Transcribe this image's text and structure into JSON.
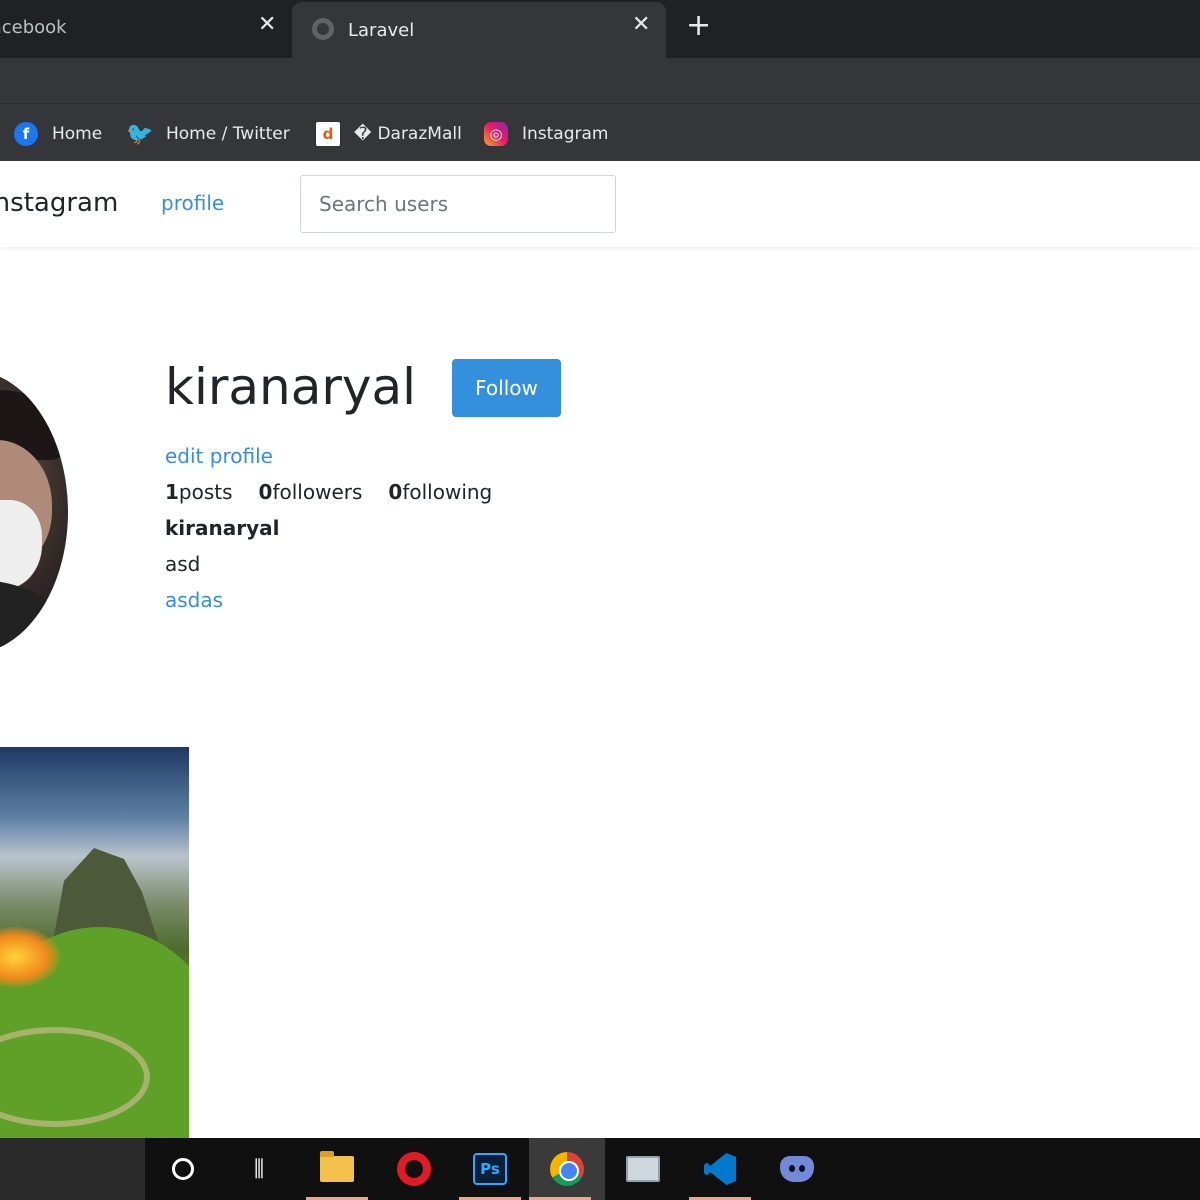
{
  "browser": {
    "tabs": [
      {
        "title": "Facebook",
        "close": "✕"
      },
      {
        "title": "Laravel",
        "close": "✕"
      }
    ],
    "new_tab": "+",
    "bookmarks": [
      {
        "label": "Home",
        "icon": "facebook-icon"
      },
      {
        "label": "Home / Twitter",
        "icon": "twitter-icon"
      },
      {
        "label": "DarazMall",
        "icon": "daraz-icon",
        "prefix": "�"
      },
      {
        "label": "Instagram",
        "icon": "instagram-icon"
      }
    ]
  },
  "site": {
    "brand": "Instagram",
    "nav_profile": "profile",
    "search_placeholder": "Search users"
  },
  "profile": {
    "username": "kiranaryal",
    "follow_label": "Follow",
    "edit_label": "edit profile",
    "stats": {
      "posts": "1",
      "posts_label": "posts",
      "followers": "0",
      "followers_label": "followers",
      "following": "0",
      "following_label": "following"
    },
    "title": "kiranaryal",
    "description": "asd",
    "url": "asdas"
  },
  "taskbar": {
    "apps": [
      "cortana-icon",
      "task-view-icon",
      "file-explorer-icon",
      "opera-icon",
      "photoshop-icon",
      "chrome-icon",
      "monitor-icon",
      "vscode-icon",
      "discord-icon"
    ]
  },
  "colors": {
    "accent": "#3490dc",
    "chrome_dark": "#202124",
    "chrome_mid": "#35363a"
  }
}
